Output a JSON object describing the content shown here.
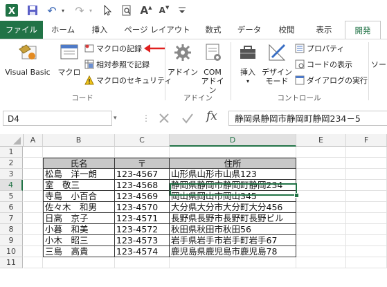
{
  "title_bar": {
    "undo_glyph": "↶",
    "redo_glyph": "↷",
    "font_a_big": "A",
    "font_a_small": "A"
  },
  "tabs": [
    {
      "label": "ファイル",
      "state": "file"
    },
    {
      "label": "ホーム"
    },
    {
      "label": "挿入"
    },
    {
      "label": "ページ レイアウト"
    },
    {
      "label": "数式"
    },
    {
      "label": "データ"
    },
    {
      "label": "校閲"
    },
    {
      "label": "表示"
    },
    {
      "label": "開発",
      "state": "active"
    }
  ],
  "ribbon": {
    "code_group": {
      "label": "コード",
      "visual_basic": "Visual Basic",
      "macro": "マクロ",
      "record_macro": "マクロの記録",
      "relative_ref": "相対参照で記録",
      "macro_security": "マクロのセキュリティ"
    },
    "addin_group": {
      "label": "アドイン",
      "addin": "アドイン",
      "com_addin_1": "COM",
      "com_addin_2": "アドイン"
    },
    "controls_group": {
      "label": "コントロール",
      "insert": "挿入",
      "design_mode_1": "デザイン",
      "design_mode_2": "モード",
      "properties": "プロパティ",
      "view_code": "コードの表示",
      "run_dialog": "ダイアログの実行"
    },
    "cutoff_label": "ソー"
  },
  "formula_bar": {
    "name_box": "D4",
    "fx": "fx",
    "content": "静岡県静岡市静岡町静岡234－5"
  },
  "columns": [
    "A",
    "B",
    "C",
    "D",
    "E",
    "F"
  ],
  "rows": [
    "1",
    "2",
    "3",
    "4",
    "5",
    "6",
    "7",
    "8",
    "9",
    "10",
    "11"
  ],
  "table": {
    "headers": [
      "氏名",
      "〒",
      "住所"
    ],
    "rows": [
      [
        "松島　洋一朗",
        "123-4567",
        "山形県山形市山県123"
      ],
      [
        "室　敬三",
        "123-4568",
        "静岡県静岡市静岡町静岡234"
      ],
      [
        "寺島　小百合",
        "123-4569",
        "岡山県岡山市岡山345"
      ],
      [
        "佐々木　和男",
        "123-4570",
        "大分県大分市大分町大分456"
      ],
      [
        "日高　京子",
        "123-4571",
        "長野県長野市長野町長野ビル"
      ],
      [
        "小暮　和美",
        "123-4572",
        "秋田県秋田市秋田56"
      ],
      [
        "小木　昭三",
        "123-4573",
        "岩手県岩手市岩手町岩手67"
      ],
      [
        "三島　高貴",
        "123-4574",
        "鹿児島県鹿児島市鹿児島78"
      ]
    ]
  },
  "colors": {
    "excel_green": "#217346",
    "arrow_red": "#e0201f"
  }
}
